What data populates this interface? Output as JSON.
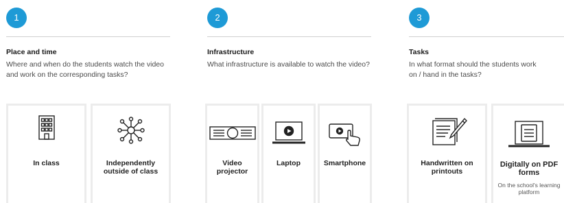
{
  "steps": [
    {
      "number": "1",
      "title": "Place and time",
      "description": "Where and when do the students watch the video and work on the corresponding tasks?",
      "options": [
        {
          "label": "In class",
          "icon": "building-icon"
        },
        {
          "label": "Independently outside of class",
          "icon": "network-icon"
        }
      ]
    },
    {
      "number": "2",
      "title": "Infrastructure",
      "description": "What infrastructure is available to watch the video?",
      "options": [
        {
          "label": "Video projector",
          "icon": "projector-icon"
        },
        {
          "label": "Laptop",
          "icon": "laptop-icon"
        },
        {
          "label": "Smartphone",
          "icon": "smartphone-icon"
        }
      ]
    },
    {
      "number": "3",
      "title": "Tasks",
      "description": "In what format should the students work on / hand in the tasks?",
      "options": [
        {
          "label": "Handwritten on printouts",
          "icon": "handwriting-icon"
        },
        {
          "label": "Digitally on PDF forms",
          "sublabel": "On the school's learning platform",
          "icon": "digital-form-icon"
        }
      ]
    }
  ],
  "colors": {
    "accent": "#1e9ad6",
    "card_border": "#ececec"
  }
}
